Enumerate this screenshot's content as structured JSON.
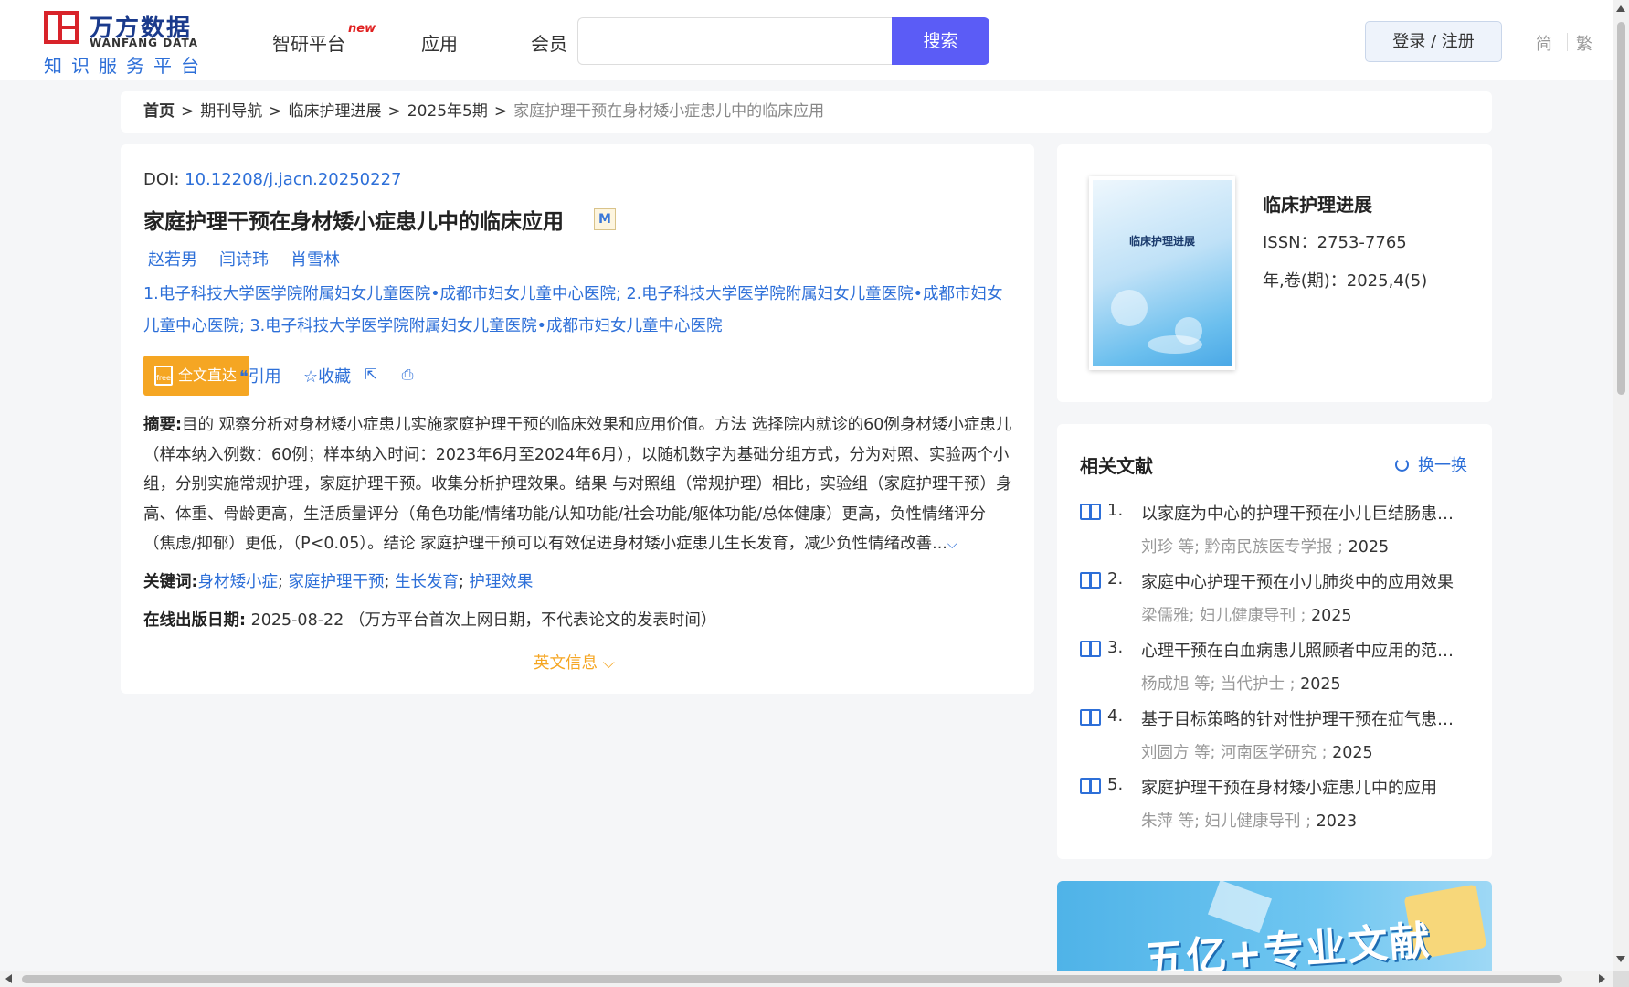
{
  "header": {
    "logo_cn": "万方数据",
    "logo_en": "WANFANG DATA",
    "logo_sub": "知识服务平台",
    "nav": [
      "智研平台",
      "应用",
      "会员"
    ],
    "nav_new_badge": "new",
    "search": {
      "value": "",
      "button": "搜索"
    },
    "login": "登录 / 注册",
    "lang_simplified": "简",
    "lang_traditional": "繁"
  },
  "breadcrumb": {
    "items": [
      "首页",
      "期刊导航",
      "临床护理进展",
      "2025年5期"
    ],
    "separator": ">",
    "current": "家庭护理干预在身材矮小症患儿中的临床应用"
  },
  "article": {
    "doi_label": "DOI: ",
    "doi": "10.12208/j.jacn.20250227",
    "title": "家庭护理干预在身材矮小症患儿中的临床应用",
    "title_badge": "M",
    "authors": [
      "赵若男",
      "闫诗玮",
      "肖雪林"
    ],
    "affiliations": "1.电子科技大学医学院附属妇女儿童医院•成都市妇女儿童中心医院; 2.电子科技大学医学院附属妇女儿童医院•成都市妇女儿童中心医院; 3.电子科技大学医学院附属妇女儿童医院•成都市妇女儿童中心医院",
    "fulltext_button": "全文直达",
    "fulltext_icon_text": "free",
    "actions": {
      "cite": "引用",
      "favorite": "收藏"
    },
    "abstract_label": "摘要:",
    "abstract": "目的 观察分析对身材矮小症患儿实施家庭护理干预的临床效果和应用价值。方法 选择院内就诊的60例身材矮小症患儿（样本纳入例数：60例；样本纳入时间：2023年6月至2024年6月），以随机数字为基础分组方式，分为对照、实验两个小组，分别实施常规护理，家庭护理干预。收集分析护理效果。结果 与对照组（常规护理）相比，实验组（家庭护理干预）身高、体重、骨龄更高，生活质量评分（角色功能/情绪功能/认知功能/社会功能/躯体功能/总体健康）更高，负性情绪评分（焦虑/抑郁）更低，（P<0.05）。结论 家庭护理干预可以有效促进身材矮小症患儿生长发育，减少负性情绪改善...",
    "keywords_label": "关键词:",
    "keywords": [
      "身材矮小症",
      "家庭护理干预",
      "生长发育",
      "护理效果"
    ],
    "pubdate_label": "在线出版日期:",
    "pubdate": "2025-08-22",
    "pubdate_note": "（万方平台首次上网日期，不代表论文的发表时间）",
    "english_info": "英文信息"
  },
  "journal": {
    "cover_title": "临床护理进展",
    "name": "临床护理进展",
    "issn": "ISSN：2753-7765",
    "volume": "年,卷(期)：2025,4(5)"
  },
  "related": {
    "title": "相关文献",
    "refresh": "换一换",
    "items": [
      {
        "num": "1.",
        "title": "以家庭为中心的护理干预在小儿巨结肠患儿中的应用",
        "meta": "刘珍  等;  黔南民族医专学报 ;",
        "year": "2025"
      },
      {
        "num": "2.",
        "title": "家庭中心护理干预在小儿肺炎中的应用效果",
        "meta": "梁儒雅; 妇儿健康导刊 ;",
        "year": "2025"
      },
      {
        "num": "3.",
        "title": "心理干预在白血病患儿照顾者中应用的范围综述",
        "meta": "杨成旭  等;  当代护士 ;",
        "year": "2025"
      },
      {
        "num": "4.",
        "title": "基于目标策略的针对性护理干预在疝气患儿中的应用",
        "meta": "刘圆方  等;  河南医学研究 ;",
        "year": "2025"
      },
      {
        "num": "5.",
        "title": "家庭护理干预在身材矮小症患儿中的应用",
        "meta": "朱萍  等;  妇儿健康导刊 ;",
        "year": "2023"
      }
    ]
  },
  "banner": {
    "text": "五亿+专业文献"
  }
}
